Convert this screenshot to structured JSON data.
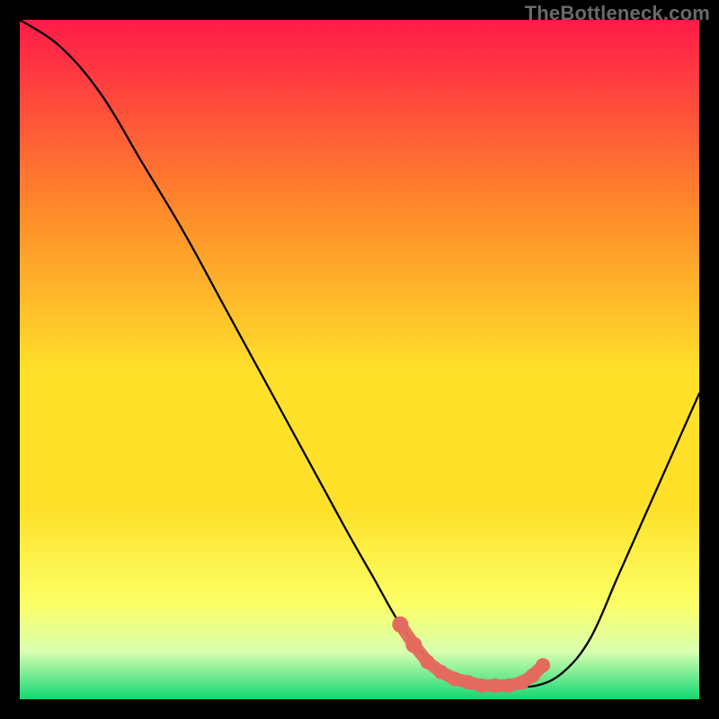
{
  "watermark": "TheBottleneck.com",
  "colors": {
    "background": "#000000",
    "gradient_top": "#ff1a4a",
    "gradient_upper_mid": "#ff8a2a",
    "gradient_mid": "#ffe12a",
    "gradient_low": "#fbff66",
    "gradient_lower": "#d9ffb0",
    "gradient_bottom": "#11d874",
    "curve": "#000000",
    "marker_fill": "#e46a5e",
    "marker_stroke": "#e46a5e"
  },
  "chart_data": {
    "type": "line",
    "title": "",
    "xlabel": "",
    "ylabel": "",
    "xlim": [
      0,
      100
    ],
    "ylim": [
      0,
      100
    ],
    "grid": false,
    "series": [
      {
        "name": "bottleneck-curve",
        "x": [
          0,
          6,
          12,
          18,
          24,
          30,
          36,
          42,
          48,
          52,
          56,
          60,
          64,
          68,
          72,
          76,
          80,
          84,
          88,
          92,
          96,
          100
        ],
        "y": [
          100,
          96,
          89,
          79,
          69,
          58,
          47,
          36,
          25,
          18,
          11,
          6,
          3,
          2,
          2,
          2,
          4,
          9,
          18,
          27,
          36,
          45
        ]
      }
    ],
    "markers": {
      "name": "highlighted-points",
      "points": [
        {
          "x": 56,
          "y": 11
        },
        {
          "x": 58,
          "y": 8
        },
        {
          "x": 60,
          "y": 5.5
        },
        {
          "x": 62,
          "y": 4
        },
        {
          "x": 64,
          "y": 3
        },
        {
          "x": 66,
          "y": 2.5
        },
        {
          "x": 68,
          "y": 2
        },
        {
          "x": 70,
          "y": 2
        },
        {
          "x": 72,
          "y": 2
        },
        {
          "x": 74,
          "y": 2.5
        },
        {
          "x": 75.5,
          "y": 3.5
        },
        {
          "x": 77,
          "y": 5
        }
      ]
    }
  }
}
